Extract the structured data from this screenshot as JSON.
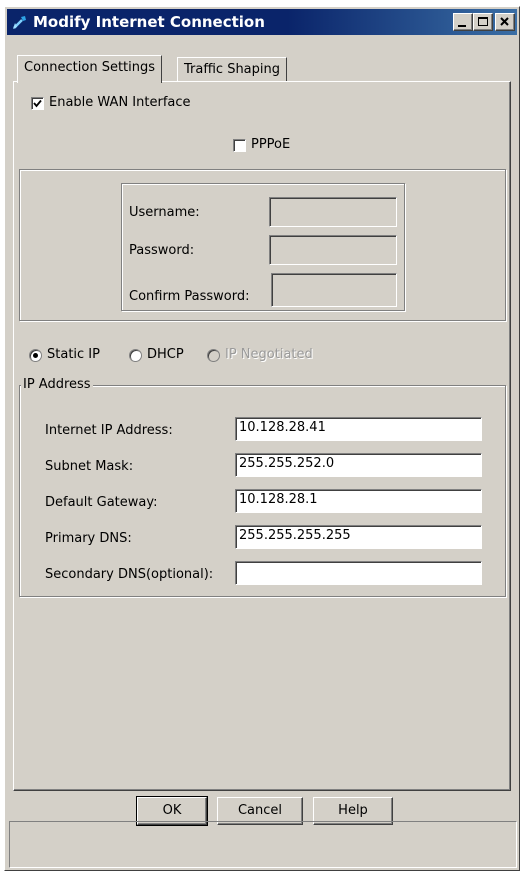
{
  "window": {
    "title": "Modify Internet Connection",
    "icon": "network-tool-icon"
  },
  "tabs": [
    {
      "label": "Connection Settings",
      "active": true
    },
    {
      "label": "Traffic Shaping",
      "active": false
    }
  ],
  "wan": {
    "enable_label": "Enable WAN Interface",
    "enabled": true,
    "pppoe_label": "PPPoE",
    "pppoe_checked": false
  },
  "pppoe_fields": {
    "username_label": "Username:",
    "username_value": "",
    "password_label": "Password:",
    "password_value": "",
    "confirm_label": "Confirm Password:",
    "confirm_value": ""
  },
  "mode": {
    "options": [
      {
        "label": "Static IP",
        "selected": true,
        "enabled": true
      },
      {
        "label": "DHCP",
        "selected": false,
        "enabled": true
      },
      {
        "label": "IP Negotiated",
        "selected": false,
        "enabled": false
      }
    ]
  },
  "ip_group": {
    "title": "IP Address",
    "fields": [
      {
        "label": "Internet IP Address:",
        "value": "10.128.28.41"
      },
      {
        "label": "Subnet Mask:",
        "value": "255.255.252.0"
      },
      {
        "label": "Default Gateway:",
        "value": "10.128.28.1"
      },
      {
        "label": "Primary DNS:",
        "value": "255.255.255.255"
      },
      {
        "label": "Secondary DNS(optional):",
        "value": ""
      }
    ]
  },
  "buttons": {
    "ok": "OK",
    "cancel": "Cancel",
    "help": "Help"
  },
  "colors": {
    "titlebar": "#0a246a",
    "face": "#d4d0c8"
  }
}
